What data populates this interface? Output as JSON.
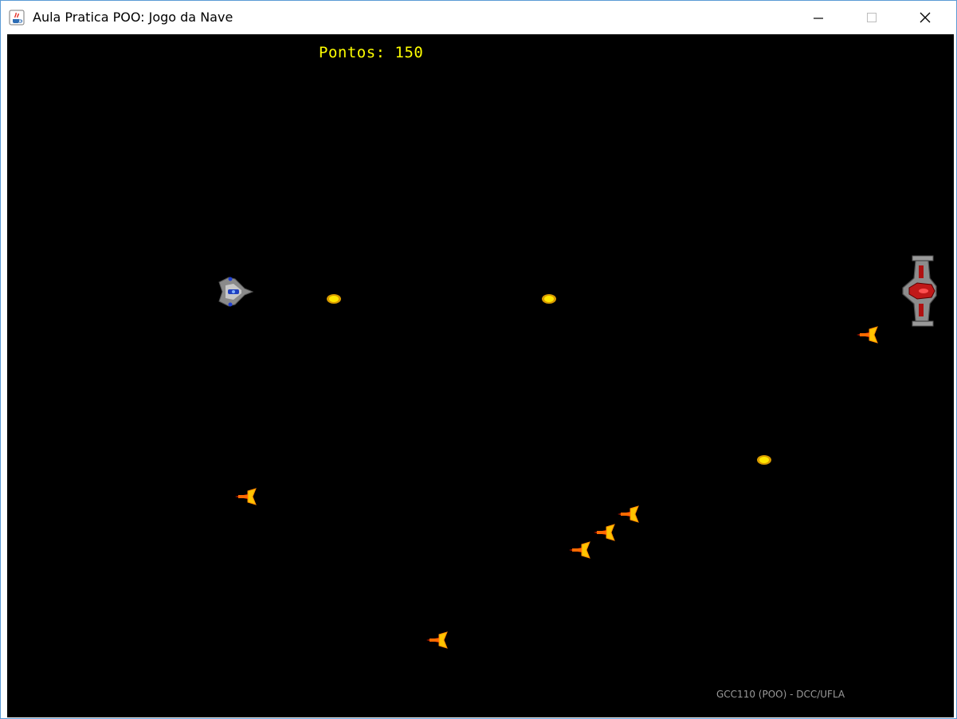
{
  "window": {
    "title": "Aula Pratica POO: Jogo da Nave",
    "icon": "java-cup-icon",
    "controls": [
      "minimize-icon",
      "maximize-icon",
      "close-icon"
    ]
  },
  "hud": {
    "score_text": "Pontos: 150",
    "score_color": "#ffff00",
    "footer_text": "GCC110 (POO) - DCC/UFLA"
  },
  "colors": {
    "background": "#000000",
    "projectile": "#ffd400",
    "missile": "#ff2a00"
  },
  "entities": {
    "player_ship": "player-ship-icon",
    "enemy_ship": "enemy-ship-icon",
    "projectiles": 3,
    "enemy_missiles": 6
  }
}
